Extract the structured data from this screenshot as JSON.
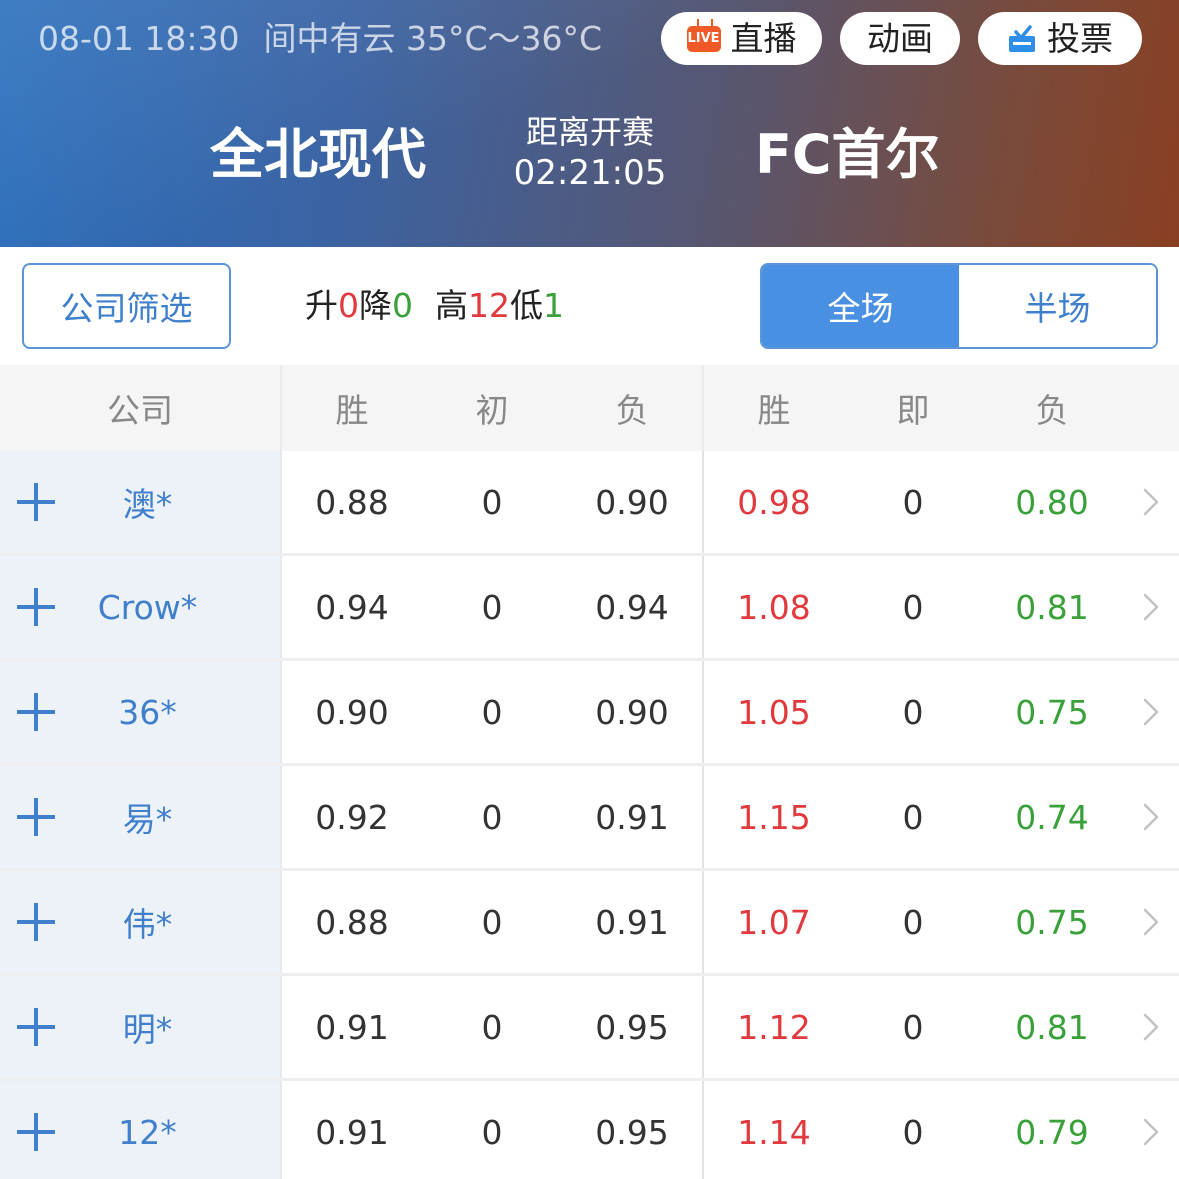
{
  "header": {
    "datetime": "08-01 18:30",
    "weather": "间中有云 35°C～36°C",
    "buttons": {
      "live_badge": "LIVE",
      "live": "直播",
      "animation": "动画",
      "vote": "投票"
    },
    "home_team": "全北现代",
    "away_team": "FC首尔",
    "countdown_label": "距离开赛",
    "countdown_time": "02:21:05"
  },
  "filter": {
    "company_filter": "公司筛选",
    "stats": {
      "up_label": "升",
      "up_value": "0",
      "down_label": "降",
      "down_value": "0",
      "high_label": "高",
      "high_value": "12",
      "low_label": "低",
      "low_value": "1"
    },
    "tabs": [
      "全场",
      "半场"
    ],
    "active_tab": "全场"
  },
  "table": {
    "headers": [
      "公司",
      "胜",
      "初",
      "负",
      "胜",
      "即",
      "负"
    ],
    "rows": [
      {
        "company": "澳*",
        "init_win": "0.88",
        "init_line": "0",
        "init_lose": "0.90",
        "live_win": "0.98",
        "live_line": "0",
        "live_lose": "0.80"
      },
      {
        "company": "Crow*",
        "init_win": "0.94",
        "init_line": "0",
        "init_lose": "0.94",
        "live_win": "1.08",
        "live_line": "0",
        "live_lose": "0.81"
      },
      {
        "company": "36*",
        "init_win": "0.90",
        "init_line": "0",
        "init_lose": "0.90",
        "live_win": "1.05",
        "live_line": "0",
        "live_lose": "0.75"
      },
      {
        "company": "易*",
        "init_win": "0.92",
        "init_line": "0",
        "init_lose": "0.91",
        "live_win": "1.15",
        "live_line": "0",
        "live_lose": "0.74"
      },
      {
        "company": "伟*",
        "init_win": "0.88",
        "init_line": "0",
        "init_lose": "0.91",
        "live_win": "1.07",
        "live_line": "0",
        "live_lose": "0.75"
      },
      {
        "company": "明*",
        "init_win": "0.91",
        "init_line": "0",
        "init_lose": "0.95",
        "live_win": "1.12",
        "live_line": "0",
        "live_lose": "0.81"
      },
      {
        "company": "12*",
        "init_win": "0.91",
        "init_line": "0",
        "init_lose": "0.95",
        "live_win": "1.14",
        "live_line": "0",
        "live_lose": "0.79"
      }
    ]
  },
  "colors": {
    "accent": "#4a90e2",
    "company_text": "#3f7fcb",
    "up": "#e0393e",
    "down": "#3aa13a",
    "live_icon": "#f05a28"
  },
  "icons": [
    "live-icon",
    "vote-icon",
    "plus-icon",
    "chevron-right-icon"
  ]
}
